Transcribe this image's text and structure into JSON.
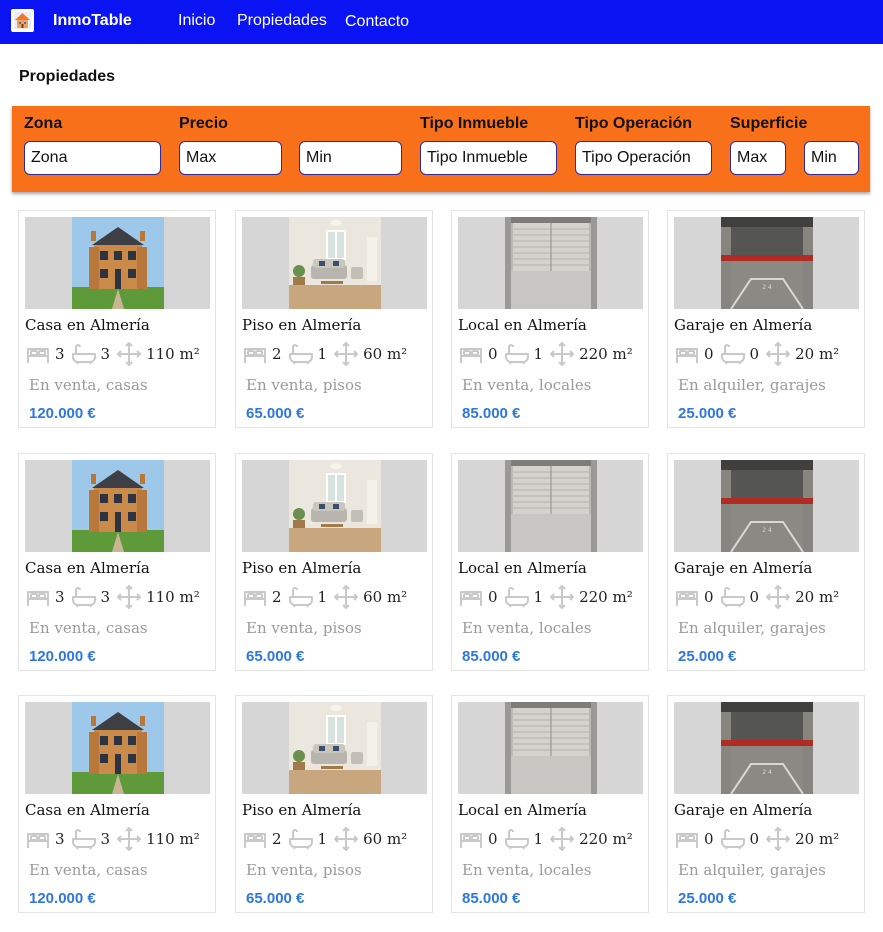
{
  "nav": {
    "brand": "InmoTable",
    "links": [
      "Inicio",
      "Propiedades",
      "Contacto"
    ],
    "logo_icon": "house-logo-icon"
  },
  "page": {
    "title": "Propiedades"
  },
  "filters": {
    "zona": {
      "label": "Zona",
      "placeholder": "Zona"
    },
    "precio": {
      "label": "Precio",
      "max_placeholder": "Max",
      "min_placeholder": "Min"
    },
    "tipo_inmueble": {
      "label": "Tipo Inmueble",
      "placeholder": "Tipo Inmueble"
    },
    "tipo_operacion": {
      "label": "Tipo Operación",
      "placeholder": "Tipo Operación"
    },
    "superficie": {
      "label": "Superficie",
      "max_placeholder": "Max",
      "min_placeholder": "Min"
    }
  },
  "colors": {
    "nav_bg": "#0a14f2",
    "filter_bg": "#f8711a",
    "price": "#2e77e0"
  },
  "icons": [
    "bed-icon",
    "bath-icon",
    "area-arrows-icon"
  ],
  "rows": [
    {
      "cards": [
        {
          "title": "Casa en Almería",
          "beds": "3",
          "baths": "3",
          "area": "110 m²",
          "subtitle": "En venta, casas",
          "price": "120.000 €",
          "image": "house"
        },
        {
          "title": "Piso en Almería",
          "beds": "2",
          "baths": "1",
          "area": "60 m²",
          "subtitle": "En venta, pisos",
          "price": "65.000 €",
          "image": "flat"
        },
        {
          "title": "Local en Almería",
          "beds": "0",
          "baths": "1",
          "area": "220 m²",
          "subtitle": "En venta, locales",
          "price": "85.000 €",
          "image": "shop"
        },
        {
          "title": "Garaje en Almería",
          "beds": "0",
          "baths": "0",
          "area": "20 m²",
          "subtitle": "En alquiler, garajes",
          "price": "25.000 €",
          "image": "garage"
        }
      ]
    },
    {
      "cards": [
        {
          "title": "Casa en Almería",
          "beds": "3",
          "baths": "3",
          "area": "110 m²",
          "subtitle": "En venta, casas",
          "price": "120.000 €",
          "image": "house"
        },
        {
          "title": "Piso en Almería",
          "beds": "2",
          "baths": "1",
          "area": "60 m²",
          "subtitle": "En venta, pisos",
          "price": "65.000 €",
          "image": "flat"
        },
        {
          "title": "Local en Almería",
          "beds": "0",
          "baths": "1",
          "area": "220 m²",
          "subtitle": "En venta, locales",
          "price": "85.000 €",
          "image": "shop"
        },
        {
          "title": "Garaje en Almería",
          "beds": "0",
          "baths": "0",
          "area": "20 m²",
          "subtitle": "En alquiler, garajes",
          "price": "25.000 €",
          "image": "garage"
        }
      ]
    },
    {
      "cards": [
        {
          "title": "Casa en Almería",
          "beds": "3",
          "baths": "3",
          "area": "110 m²",
          "subtitle": "En venta, casas",
          "price": "120.000 €",
          "image": "house"
        },
        {
          "title": "Piso en Almería",
          "beds": "2",
          "baths": "1",
          "area": "60 m²",
          "subtitle": "En venta, pisos",
          "price": "65.000 €",
          "image": "flat"
        },
        {
          "title": "Local en Almería",
          "beds": "0",
          "baths": "1",
          "area": "220 m²",
          "subtitle": "En venta, locales",
          "price": "85.000 €",
          "image": "shop"
        },
        {
          "title": "Garaje en Almería",
          "beds": "0",
          "baths": "0",
          "area": "20 m²",
          "subtitle": "En alquiler, garajes",
          "price": "25.000 €",
          "image": "garage"
        }
      ]
    }
  ]
}
